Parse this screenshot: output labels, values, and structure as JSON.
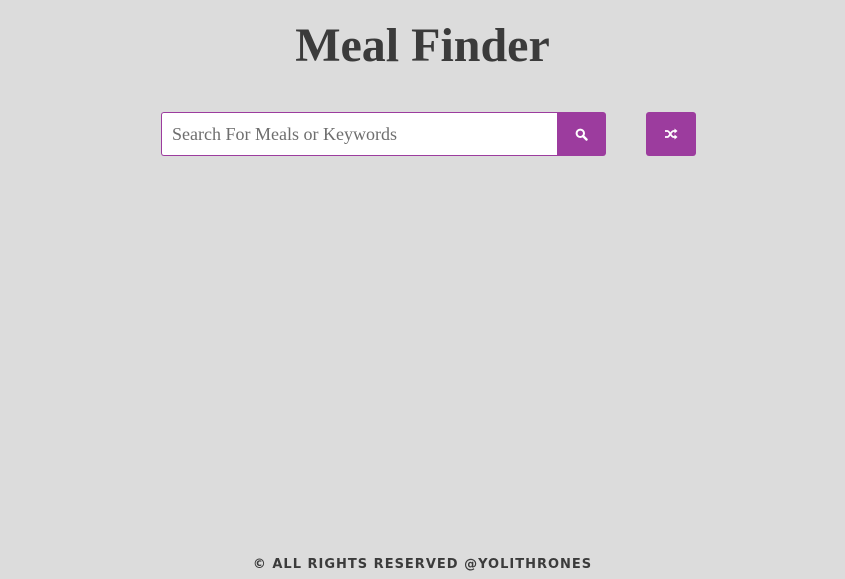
{
  "header": {
    "title": "Meal Finder"
  },
  "search": {
    "placeholder": "Search For Meals or Keywords",
    "value": "",
    "search_icon": "search-icon",
    "random_icon": "shuffle-icon"
  },
  "footer": {
    "text": "© ALL RIGHTS RESERVED @YOLITHRONES"
  },
  "colors": {
    "background": "#dcdcdc",
    "accent": "#9c3c9e",
    "text": "#3b3b3b"
  }
}
